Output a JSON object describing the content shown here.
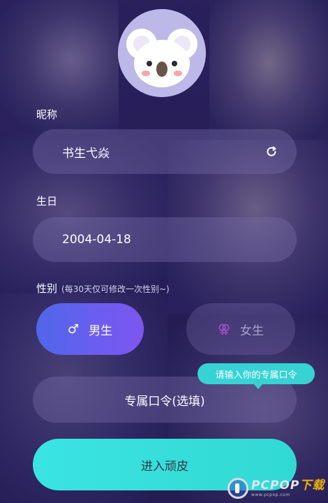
{
  "form": {
    "nickname_label": "昵称",
    "nickname_value": "书生弋焱",
    "birthday_label": "生日",
    "birthday_value": "2004-04-18",
    "gender_label": "性别",
    "gender_hint": "(每30天仅可修改一次性别~)",
    "male_label": "男生",
    "female_label": "女生",
    "male_symbol": "♂",
    "female_symbol": "⚢",
    "selected_gender": "male",
    "code_placeholder": "专属口令(选填)",
    "code_tooltip": "请输入你的专属口令",
    "enter_button": "进入顽皮"
  },
  "avatar": {
    "icon": "koala-avatar-icon"
  },
  "watermark": {
    "title_main": "PCPOP",
    "title_accent": "下载",
    "subtitle": "www.pcpop.com"
  },
  "colors": {
    "accent_blue": "#5a63ee",
    "accent_cyan": "#36d2d4",
    "female_pink": "#b14fd6"
  }
}
